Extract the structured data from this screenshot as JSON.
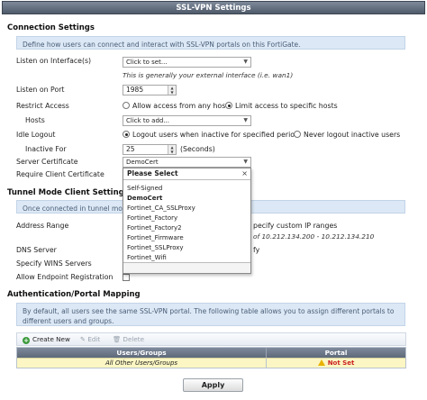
{
  "window": {
    "title": "SSL-VPN Settings"
  },
  "connection": {
    "section_title": "Connection Settings",
    "info": "Define how users can connect and interact with SSL-VPN portals on this FortiGate.",
    "listen_interface_label": "Listen on Interface(s)",
    "listen_interface_value": "Click to set...",
    "listen_interface_hint": "This is generally your external interface (i.e. wan1)",
    "listen_port_label": "Listen on Port",
    "listen_port_value": "1985",
    "restrict_label": "Restrict Access",
    "restrict_option_any": "Allow access from any host",
    "restrict_option_specific": "Limit access to specific hosts",
    "restrict_selected": "specific",
    "hosts_label": "Hosts",
    "hosts_value": "Click to add...",
    "idle_label": "Idle Logout",
    "idle_option_logout": "Logout users when inactive for specified period",
    "idle_option_never": "Never logout inactive users",
    "idle_selected": "logout",
    "inactive_label": "Inactive For",
    "inactive_value": "25",
    "inactive_unit": "(Seconds)",
    "server_cert_label": "Server Certificate",
    "server_cert_value": "DemoCert",
    "client_cert_label": "Require Client Certificate"
  },
  "cert_dropdown": {
    "header": "Please Select",
    "items": [
      "Self-Signed",
      "DemoCert",
      "Fortinet_CA_SSLProxy",
      "Fortinet_Factory",
      "Fortinet_Factory2",
      "Fortinet_Firmware",
      "Fortinet_SSLProxy",
      "Fortinet_Wifi"
    ],
    "bold_item": "DemoCert"
  },
  "tunnel": {
    "section_title": "Tunnel Mode Client Settings",
    "info": "Once connected in tunnel mod",
    "address_range_label": "Address Range",
    "address_range_partial": "pecify custom IP ranges",
    "address_range_hint": "of 10.212.134.200 - 10.212.134.210",
    "dns_label": "DNS Server",
    "dns_partial": "fy",
    "wins_label": "Specify WINS Servers",
    "endpoint_label": "Allow Endpoint Registration"
  },
  "auth": {
    "section_title": "Authentication/Portal Mapping",
    "info": "By default, all users see the same SSL-VPN portal. The following table allows you to assign different portals to different users and groups.",
    "toolbar": {
      "create_new": "Create New",
      "edit": "Edit",
      "delete": "Delete"
    },
    "table": {
      "columns": [
        "Users/Groups",
        "Portal"
      ],
      "rows": [
        {
          "users": "All Other Users/Groups",
          "portal": "Not Set"
        }
      ]
    }
  },
  "footer": {
    "apply_label": "Apply"
  },
  "colors": {
    "title_bar": "#5d6879",
    "info_bg": "#dce8f5",
    "row_highlight": "#fbf6c3",
    "warning": "#cc2222"
  }
}
